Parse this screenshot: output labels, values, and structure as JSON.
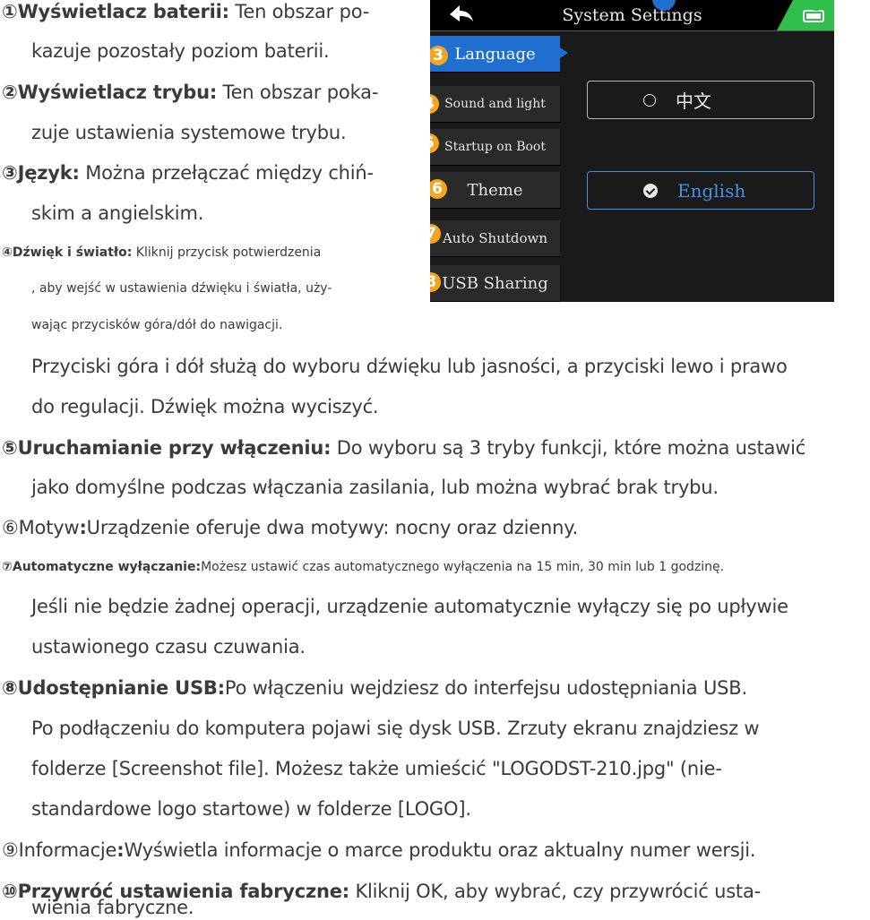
{
  "device": {
    "title": "System Settings",
    "menu": [
      {
        "label": "Language",
        "badge": "3"
      },
      {
        "label": "Sound and light",
        "badge": "4"
      },
      {
        "label": "Startup on Boot",
        "badge": "5"
      },
      {
        "label": "Theme",
        "badge": "6"
      },
      {
        "label": "Auto Shutdown",
        "badge": "7"
      },
      {
        "label": "USB Sharing",
        "badge": "8"
      }
    ],
    "options": [
      {
        "label": "中文",
        "selected": false
      },
      {
        "label": "English",
        "selected": true
      }
    ],
    "colors": {
      "accent": "#1e6fd0",
      "badge": "#f3a51e",
      "battery": "#2fbf4a",
      "selected_option": "#4a90e2"
    }
  },
  "items": {
    "i1": {
      "num": "①",
      "title": "Wyświetlacz baterii:",
      "l1": " Ten obszar po-",
      "l2": "kazuje pozostały poziom baterii."
    },
    "i2": {
      "num": "②",
      "title": "Wyświetlacz trybu:",
      "l1": " Ten obszar poka-",
      "l2": "zuje ustawienia systemowe trybu."
    },
    "i3": {
      "num": "③",
      "title": "Język:",
      "l1": " Można przełączać między chiń-",
      "l2": "skim a angielskim."
    },
    "i4": {
      "num": "④",
      "title": "Dźwięk i światło:",
      "l1": " Kliknij przycisk potwierdzenia",
      "l2": ", aby wejść w ustawienia dźwięku i światła, uży-",
      "l3": "wając przycisków góra/dół do nawigacji.",
      "l4": "Przyciski góra i dół służą do wyboru dźwięku lub jasności, a przyciski lewo i prawo",
      "l5": "do regulacji.  Dźwięk można wyciszyć."
    },
    "i5": {
      "num": "⑤",
      "title": "Uruchamianie przy włączeniu:",
      "l1": " Do wyboru są 3 tryby funkcji, które można ustawić",
      "l2": "jako domyślne podczas włączania zasilania, lub można wybrać brak trybu."
    },
    "i6": {
      "num": "⑥",
      "title": "Motyw",
      "colon": ":",
      "l1": "Urządzenie oferuje dwa motywy: nocny oraz dzienny."
    },
    "i7": {
      "num": "⑦",
      "title": "Automatyczne wyłączanie:",
      "l1": "Możesz ustawić czas automatycznego wyłączenia na 15 min, 30 min lub 1 godzinę.",
      "l2": "Jeśli nie będzie żadnej operacji, urządzenie automatycznie wyłączy się po upływie",
      "l3": "ustawionego czasu czuwania."
    },
    "i8": {
      "num": "⑧",
      "title": "Udostępnianie USB:",
      "l1": "Po włączeniu wejdziesz do interfejsu udostępniania USB.",
      "l2": "Po podłączeniu do komputera pojawi się dysk USB. Zrzuty ekranu znajdziesz w",
      "l3": "folderze [Screenshot file].  Możesz także umieścić  \"LOGODST-210.jpg\" (nie-",
      "l4": "standardowe logo startowe) w folderze [LOGO]."
    },
    "i9": {
      "num": "⑨",
      "title": "Informacje",
      "colon": ":",
      "l1": "Wyświetla informacje o marce produktu oraz aktualny numer wersji."
    },
    "i10": {
      "num": "⑩",
      "title": "Przywróć ustawienia fabryczne:",
      "l1": " Kliknij OK, aby wybrać, czy przywrócić usta-",
      "l2": "wienia fabryczne."
    }
  }
}
